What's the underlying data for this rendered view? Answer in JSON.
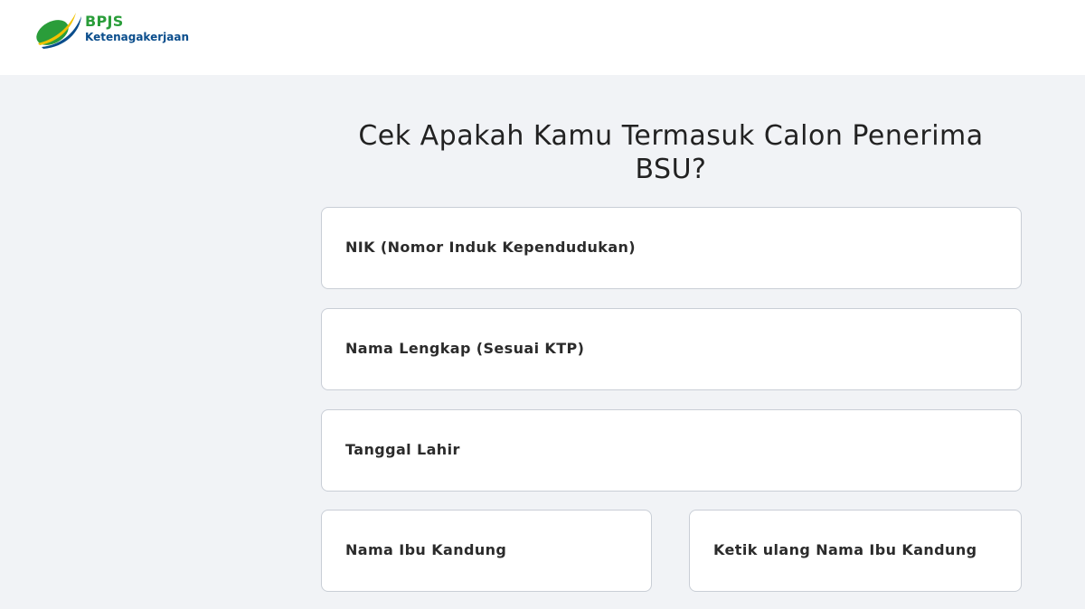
{
  "header": {
    "logo": {
      "brand": "BPJS",
      "subtitle": "Ketenagakerjaan",
      "icon": "bpjs-leaf-icon",
      "colors": {
        "green": "#2a9d3a",
        "blue": "#0a4d8c",
        "yellow": "#f2c200"
      }
    }
  },
  "form": {
    "title": "Cek Apakah Kamu Termasuk Calon Penerima BSU?",
    "fields": {
      "nik": "NIK (Nomor Induk Kependudukan)",
      "nama_lengkap": "Nama Lengkap (Sesuai KTP)",
      "tanggal_lahir": "Tanggal Lahir",
      "nama_ibu": "Nama Ibu Kandung",
      "nama_ibu_ulang": "Ketik ulang Nama Ibu Kandung"
    }
  }
}
